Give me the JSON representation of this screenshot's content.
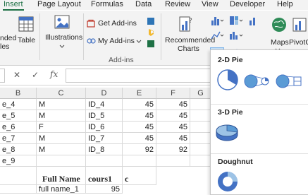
{
  "ribbon_tabs": [
    "Insert",
    "Page Layout",
    "Formulas",
    "Data",
    "Review",
    "View",
    "Developer",
    "Help"
  ],
  "active_tab": "Insert",
  "ribbon": {
    "tables_partial_1": "nded",
    "tables_partial_2": "les",
    "table_label": "Table",
    "illustrations_label": "Illustrations",
    "get_addins_label": "Get Add-ins",
    "my_addins_label": "My Add-ins",
    "addins_group_label": "Add-ins",
    "recommended_charts_line1": "Recommended",
    "recommended_charts_line2": "Charts",
    "maps_label": "Maps",
    "pivotchart_label": "PivotC"
  },
  "formula_bar": {
    "cancel_symbol": "✕",
    "enter_symbol": "✓",
    "fx_symbol": "fx",
    "value": ""
  },
  "columns": [
    "B",
    "C",
    "D",
    "E",
    "F",
    "G"
  ],
  "rows": [
    {
      "b": "e_4",
      "c": "M",
      "d": "ID_4",
      "e": "45",
      "f": "45"
    },
    {
      "b": "e_5",
      "c": "M",
      "d": "ID_5",
      "e": "45",
      "f": "45"
    },
    {
      "b": "e_6",
      "c": "F",
      "d": "ID_6",
      "e": "45",
      "f": "45"
    },
    {
      "b": "e_7",
      "c": "M",
      "d": "ID_7",
      "e": "45",
      "f": "45"
    },
    {
      "b": "e_8",
      "c": "M",
      "d": "ID_8",
      "e": "92",
      "f": "92"
    },
    {
      "b": "e_9",
      "c": "",
      "d": "",
      "e": "",
      "f": ""
    }
  ],
  "lower_table": {
    "header_full_name": "Full Name",
    "header_cours1": "cours1",
    "header_next_partial": "c",
    "row1_name": "full name_1",
    "row1_cours1": "95"
  },
  "pie_menu": {
    "section_2d": "2-D Pie",
    "section_3d": "3-D Pie",
    "section_doughnut": "Doughnut"
  },
  "colors": {
    "excel_green": "#1e7145",
    "chart_blue": "#4472c4",
    "chart_light_blue": "#5b9bd5",
    "selected_bg": "#c5dff5"
  }
}
